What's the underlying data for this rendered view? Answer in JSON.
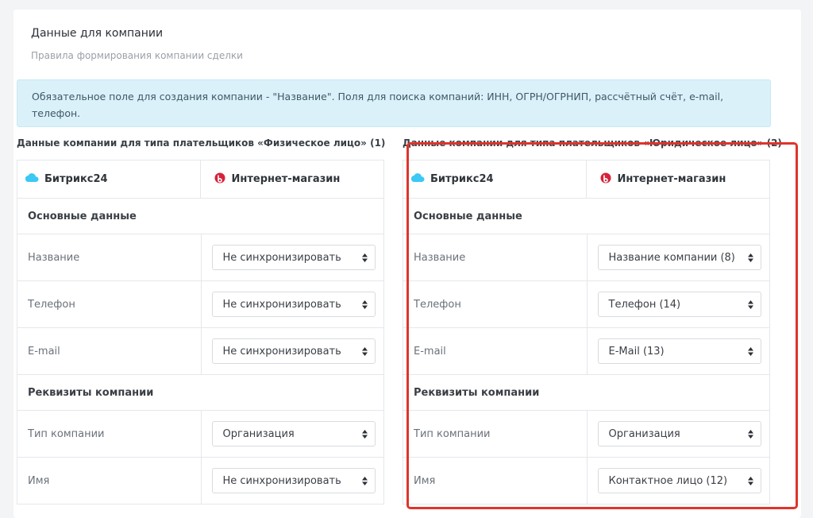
{
  "card": {
    "title": "Данные для компании",
    "subtitle": "Правила формирования компании сделки"
  },
  "alert": {
    "text": "Обязательное поле для создания компании - \"Название\". Поля для поиска компаний: ИНН, ОГРН/ОГРНИП, рассчётный счёт, e-mail, телефон."
  },
  "colors": {
    "alert_bg": "#dbf1fa",
    "highlight_border": "#e0342b",
    "bitrix_icon": "#3bc8f5",
    "shop_icon": "#d6223a"
  },
  "headers": {
    "bitrix": "Битрикс24",
    "shop": "Интернет-магазин"
  },
  "sections": [
    {
      "title": "Данные компании для типа плательщиков «Физическое лицо» (1)",
      "groups": {
        "main": "Основные данные",
        "requisites": "Реквизиты компании"
      },
      "fields": {
        "name": {
          "label": "Название",
          "value": "Не синхронизировать"
        },
        "phone": {
          "label": "Телефон",
          "value": "Не синхронизировать"
        },
        "email": {
          "label": "E-mail",
          "value": "Не синхронизировать"
        },
        "company_type": {
          "label": "Тип компании",
          "value": "Организация"
        },
        "first_name": {
          "label": "Имя",
          "value": "Не синхронизировать"
        }
      }
    },
    {
      "title": "Данные компании для типа плательщиков «Юридическое лицо» (2)",
      "groups": {
        "main": "Основные данные",
        "requisites": "Реквизиты компании"
      },
      "fields": {
        "name": {
          "label": "Название",
          "value": "Название компании (8)"
        },
        "phone": {
          "label": "Телефон",
          "value": "Телефон (14)"
        },
        "email": {
          "label": "E-mail",
          "value": "E-Mail (13)"
        },
        "company_type": {
          "label": "Тип компании",
          "value": "Организация"
        },
        "first_name": {
          "label": "Имя",
          "value": "Контактное лицо (12)"
        }
      }
    }
  ]
}
